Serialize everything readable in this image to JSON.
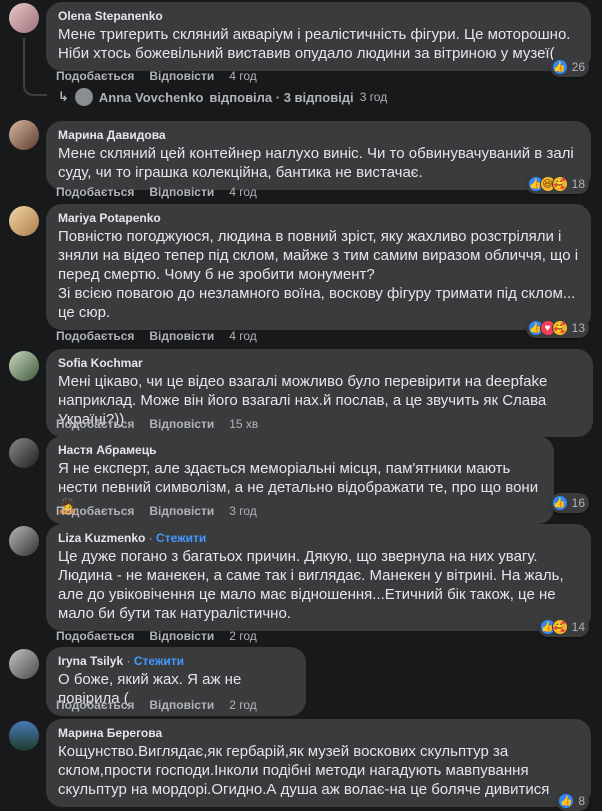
{
  "actions": {
    "like": "Подобається",
    "reply": "Відповісти"
  },
  "reply_summary": {
    "name": "Anna Vovchenko",
    "text": "відповіла · 3 відповіді",
    "time": "3 год"
  },
  "comments": [
    {
      "author": "Olena Stepanenko",
      "text": "Мене тригерить скляний акваріум і реалістичність фігури. Це моторошно. Ніби хтось божевільний виставив опудало людини за вітриною у музеї(",
      "time": "4 год",
      "reactions": [
        "like"
      ],
      "count": "26"
    },
    {
      "author": "Марина Давидова",
      "text": "Мене скляний цей контейнер наглухо виніс. Чи то обвинувачуваний в залі суду, чи то іграшка колекційна, бантика не вистачає.",
      "time": "4 год",
      "reactions": [
        "like",
        "haha",
        "care"
      ],
      "count": "18"
    },
    {
      "author": "Mariya Potapenko",
      "text": "Повністю погоджуюся, людина в повний зріст, яку жахливо розстріляли і зняли на відео тепер під склом, майже з тим самим виразом обличчя, що і перед смертю. Чому б не зробити монумент?\nЗі всією повагою до незламного воїна, воскову фігуру тримати під склом... це сюр.",
      "time": "4 год",
      "reactions": [
        "like",
        "love",
        "care"
      ],
      "count": "13"
    },
    {
      "author": "Sofia Kochmar",
      "text": "Мені цікаво, чи це відео взагалі можливо було перевірити на deepfake наприклад. Може він його взагалі нах.й послав, а це звучить як Слава Україні?))",
      "time": "15 хв",
      "reactions": [],
      "count": ""
    },
    {
      "author": "Настя Абрамець",
      "text": "Я не експерт, але здається меморіальні місця, пам'ятники мають нести певний символізм, а не детально відображати те, про що вони🙇",
      "time": "3 год",
      "reactions": [
        "like"
      ],
      "count": "16"
    },
    {
      "author": "Liza Kuzmenko",
      "follow": "Стежити",
      "text": "Це дуже погано з багатьох причин. Дякую, що звернула на них увагу. Людина - не манекен, а саме так і виглядає. Манекен у вітрині. На жаль, але до увіковічення це мало має відношення...Етичний бік також, це не мало би бути так натуралістично.",
      "time": "2 год",
      "reactions": [
        "like",
        "care"
      ],
      "count": "14"
    },
    {
      "author": "Iryna Tsilyk",
      "follow": "Стежити",
      "text": "О боже, який жах. Я аж не повірила (",
      "time": "2 год",
      "reactions": [],
      "count": ""
    },
    {
      "author": "Марина Берегова",
      "text": "Кощунство.Виглядає,як гербарій,як музей воскових скульптур за склом,прости господи.Інколи подібні методи нагадують мавпування скульптур на мордорі.Огидно.А душа аж волає-на це боляче дивитися",
      "time": "",
      "reactions": [
        "like"
      ],
      "count": "8"
    }
  ]
}
